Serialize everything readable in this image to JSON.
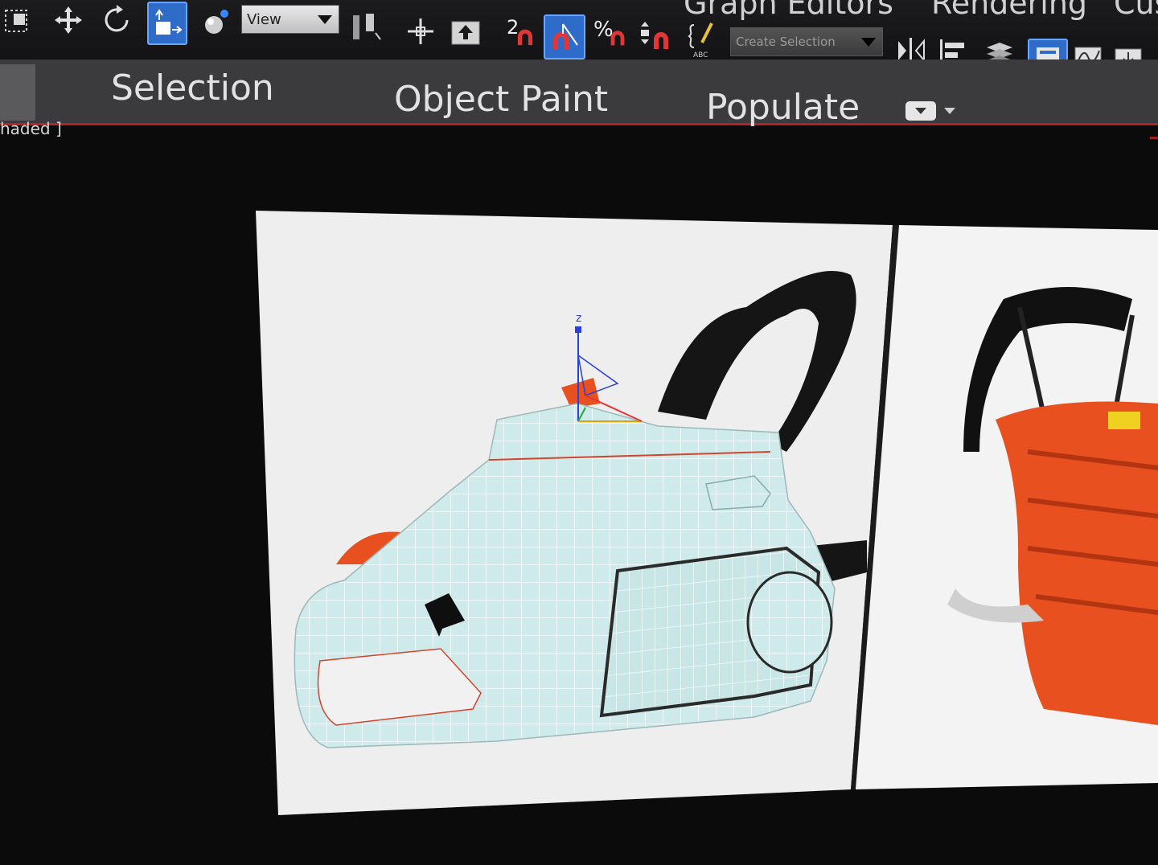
{
  "toolbar": {
    "menu_titles": [
      "Graph Editors",
      "Rendering",
      "Cus"
    ],
    "reference_coord_dropdown": "View",
    "selection_set_dropdown": "Create Selection",
    "snap_label": "2",
    "percent_snap_label": "%",
    "edit_named_sets_sub": "ABC"
  },
  "ribbon": {
    "tabs": [
      "Selection",
      "Object Paint",
      "Populate"
    ]
  },
  "viewport": {
    "label": "haded ]",
    "gizmo_axis": "z"
  },
  "colors": {
    "accent_active": "#2f6bc9",
    "ribbon_border": "#b8232a",
    "model_fill": "#cfeaea",
    "chainsaw_orange": "#e8501f"
  }
}
